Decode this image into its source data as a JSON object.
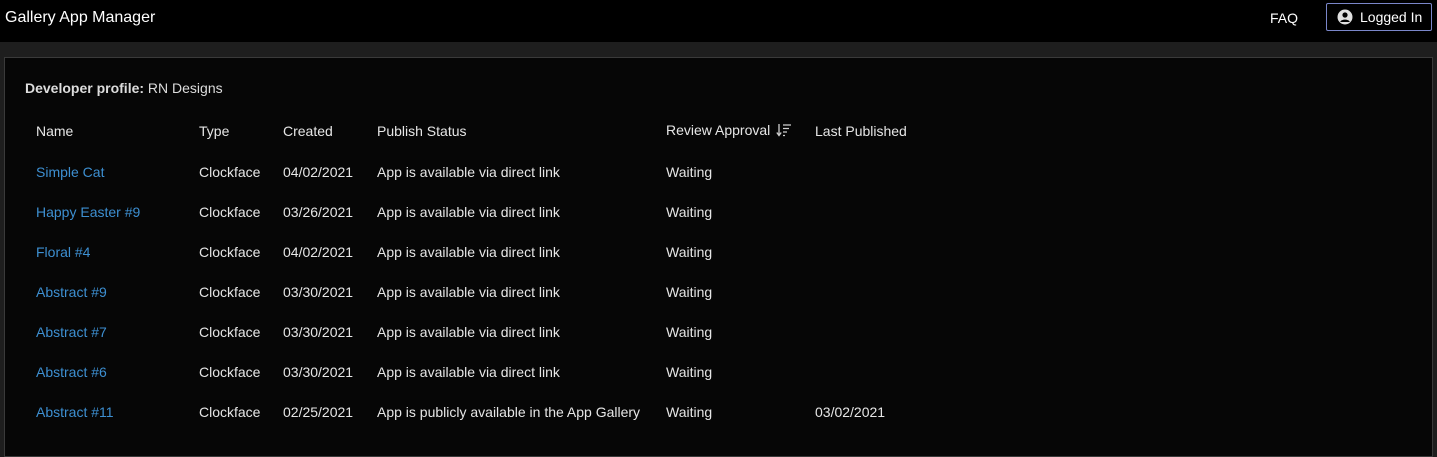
{
  "header": {
    "app_title": "Gallery App Manager",
    "faq_label": "FAQ",
    "login_label": "Logged In"
  },
  "profile": {
    "label": "Developer profile:",
    "value": "RN Designs"
  },
  "table": {
    "columns": [
      "Name",
      "Type",
      "Created",
      "Publish Status",
      "Review Approval",
      "Last Published"
    ],
    "sorted_column": "Review Approval",
    "rows": [
      {
        "name": "Simple Cat",
        "type": "Clockface",
        "created": "04/02/2021",
        "status": "App is available via direct link",
        "review": "Waiting",
        "last": ""
      },
      {
        "name": "Happy Easter #9",
        "type": "Clockface",
        "created": "03/26/2021",
        "status": "App is available via direct link",
        "review": "Waiting",
        "last": ""
      },
      {
        "name": "Floral #4",
        "type": "Clockface",
        "created": "04/02/2021",
        "status": "App is available via direct link",
        "review": "Waiting",
        "last": ""
      },
      {
        "name": "Abstract #9",
        "type": "Clockface",
        "created": "03/30/2021",
        "status": "App is available via direct link",
        "review": "Waiting",
        "last": ""
      },
      {
        "name": "Abstract #7",
        "type": "Clockface",
        "created": "03/30/2021",
        "status": "App is available via direct link",
        "review": "Waiting",
        "last": ""
      },
      {
        "name": "Abstract #6",
        "type": "Clockface",
        "created": "03/30/2021",
        "status": "App is available via direct link",
        "review": "Waiting",
        "last": ""
      },
      {
        "name": "Abstract #11",
        "type": "Clockface",
        "created": "02/25/2021",
        "status": "App is publicly available in the App Gallery",
        "review": "Waiting",
        "last": "03/02/2021"
      }
    ]
  },
  "colors": {
    "link": "#3d8fd1",
    "button_border": "#7a86c9"
  },
  "icons": [
    "user-icon",
    "sort-descending-icon"
  ]
}
